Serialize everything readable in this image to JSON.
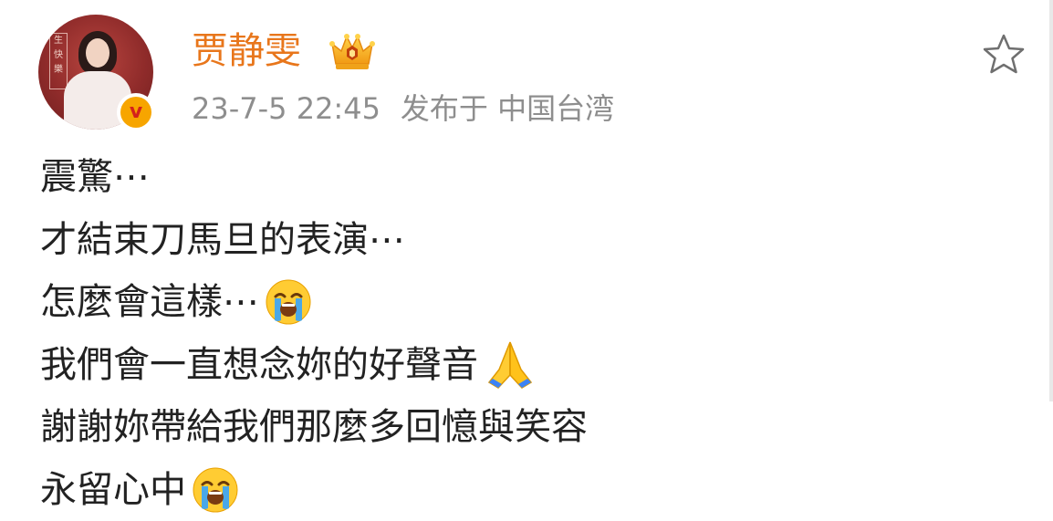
{
  "post": {
    "author": "贾静雯",
    "author_color": "#e8761b",
    "verified_icon": "v-verified-badge-icon",
    "member_icon": "crown-member-icon",
    "avatar_text": "生 快 樂",
    "timestamp": "23-7-5 22:45",
    "source": "发布于 中国台湾",
    "favorite_icon": "star-outline-icon",
    "lines": [
      {
        "text": "震驚⋯",
        "emoji": ""
      },
      {
        "text": "才結束刀馬旦的表演⋯",
        "emoji": ""
      },
      {
        "text": "怎麼會這樣⋯",
        "emoji": "loudly-crying-face-icon"
      },
      {
        "text": "我們會一直想念妳的好聲音",
        "emoji": "folded-hands-icon"
      },
      {
        "text": "謝謝妳帶給我們那麼多回憶與笑容",
        "emoji": ""
      },
      {
        "text": "永留心中",
        "emoji": "loudly-crying-face-icon"
      }
    ]
  }
}
